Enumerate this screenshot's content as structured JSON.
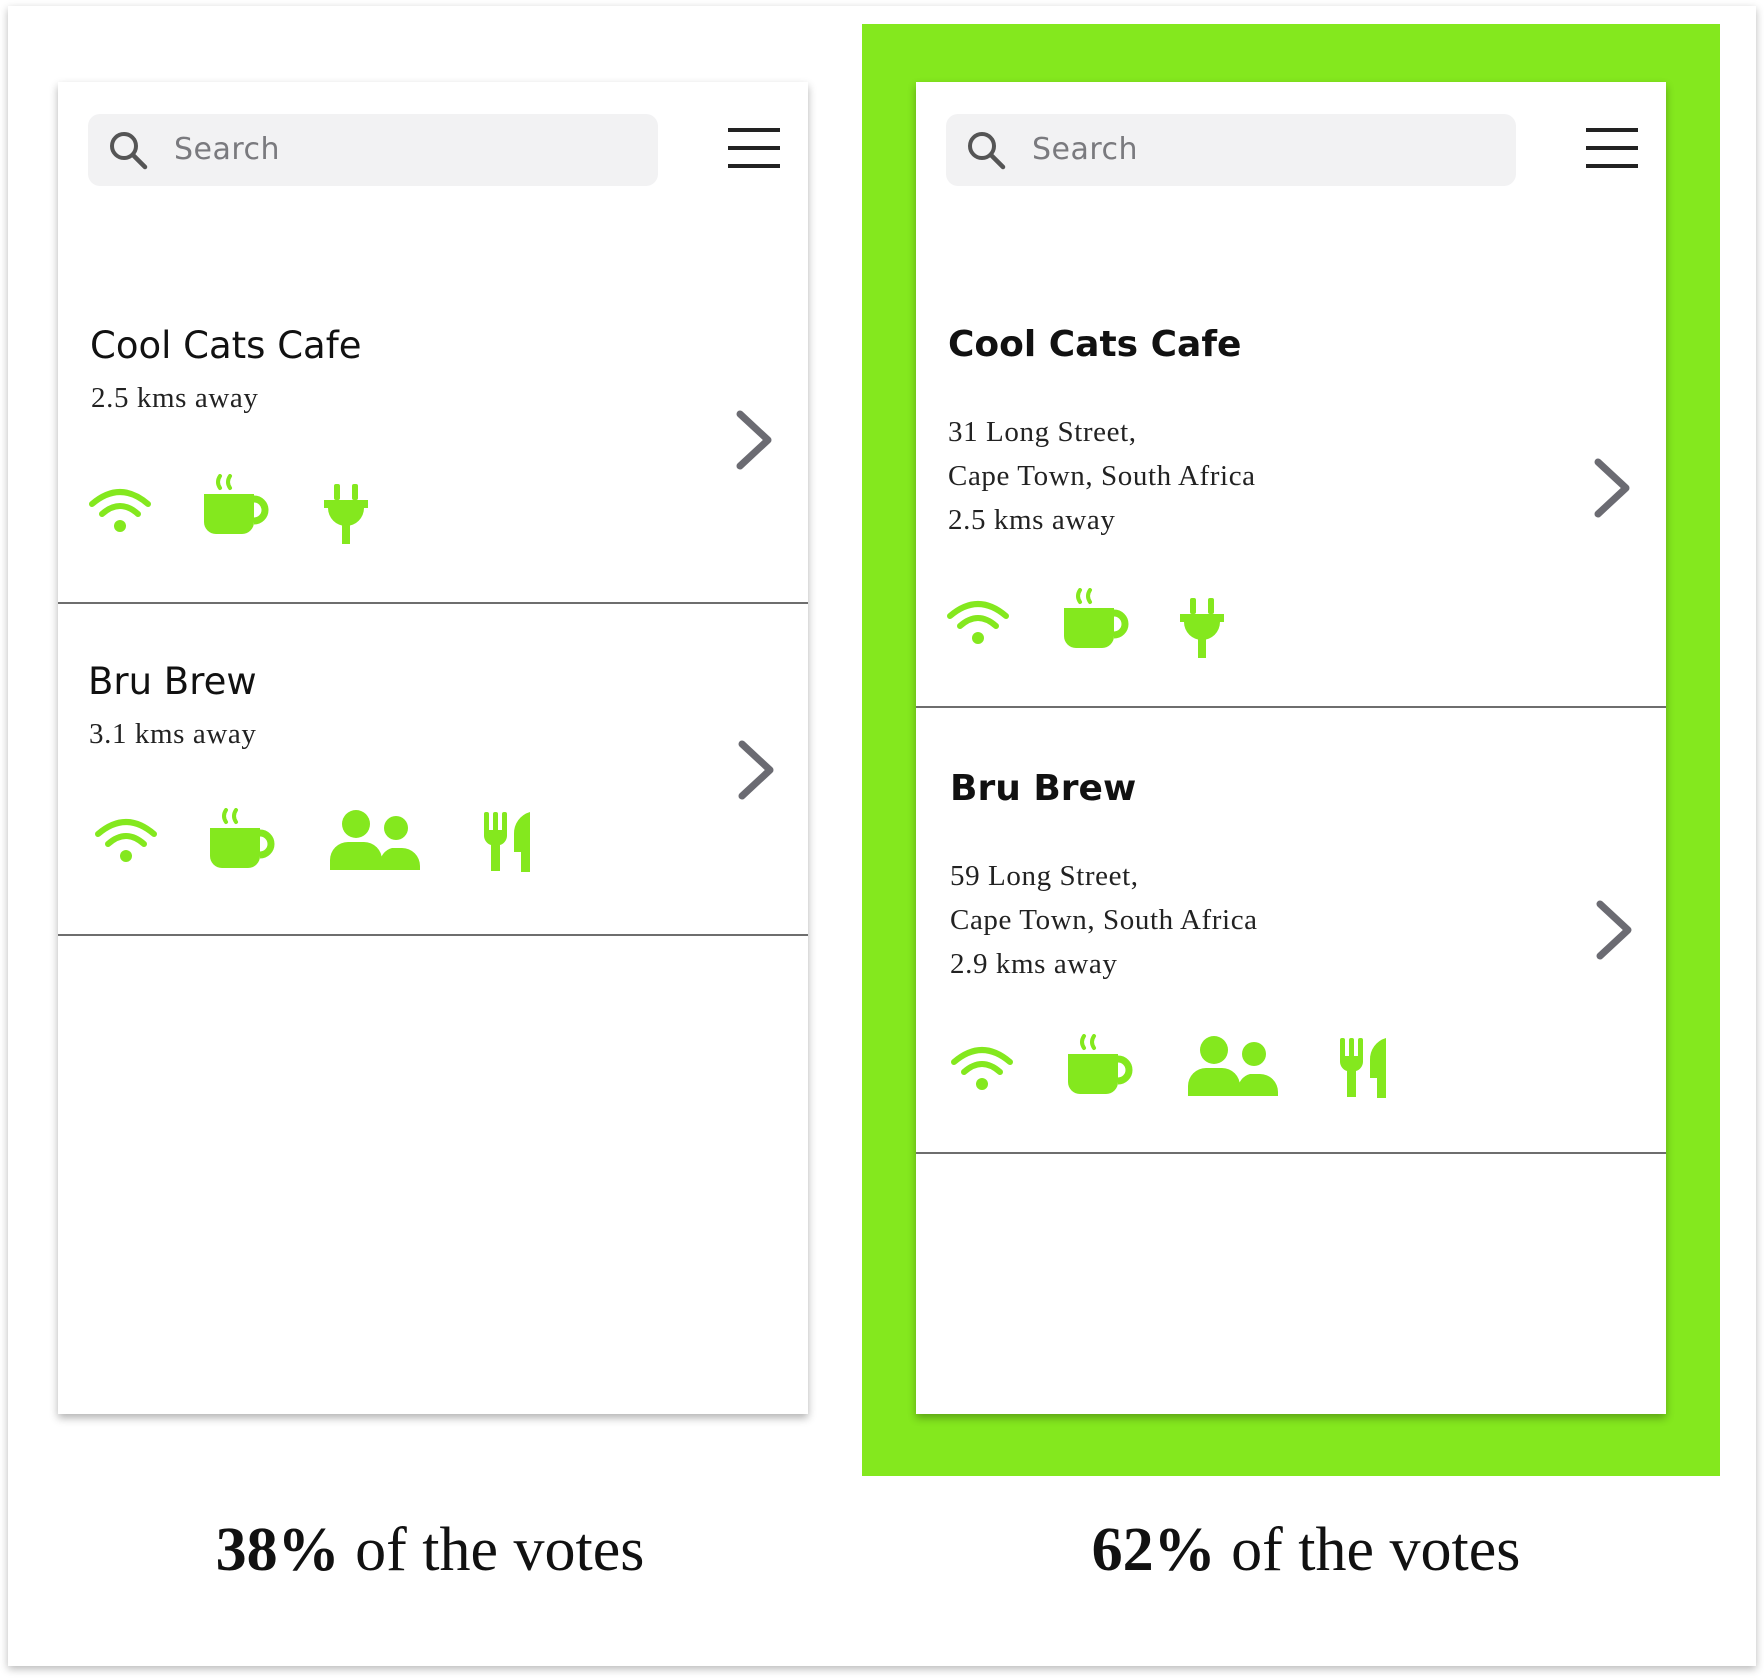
{
  "colors": {
    "accent": "#84e81e",
    "chevron": "#6b6b72",
    "divider": "#6e6e6e"
  },
  "variant_a": {
    "search_placeholder": "Search",
    "cafes": [
      {
        "name": "Cool Cats Cafe",
        "distance": "2.5 kms away",
        "amenities": [
          "wifi-icon",
          "coffee-icon",
          "power-plug-icon"
        ]
      },
      {
        "name": "Bru Brew",
        "distance": "3.1 kms away",
        "amenities": [
          "wifi-icon",
          "coffee-icon",
          "people-icon",
          "fork-knife-icon"
        ]
      }
    ],
    "votes_percent": "38%",
    "votes_suffix": " of the votes"
  },
  "variant_b": {
    "search_placeholder": "Search",
    "cafes": [
      {
        "name": "Cool Cats Cafe",
        "address_line1": "31 Long Street,",
        "address_line2": "Cape Town, South Africa",
        "distance": "2.5 kms away",
        "amenities": [
          "wifi-icon",
          "coffee-icon",
          "power-plug-icon"
        ]
      },
      {
        "name": "Bru Brew",
        "address_line1": "59 Long Street,",
        "address_line2": "Cape Town, South Africa",
        "distance": "2.9 kms away",
        "amenities": [
          "wifi-icon",
          "coffee-icon",
          "people-icon",
          "fork-knife-icon"
        ]
      }
    ],
    "votes_percent": "62%",
    "votes_suffix": " of the votes",
    "highlighted": true
  }
}
